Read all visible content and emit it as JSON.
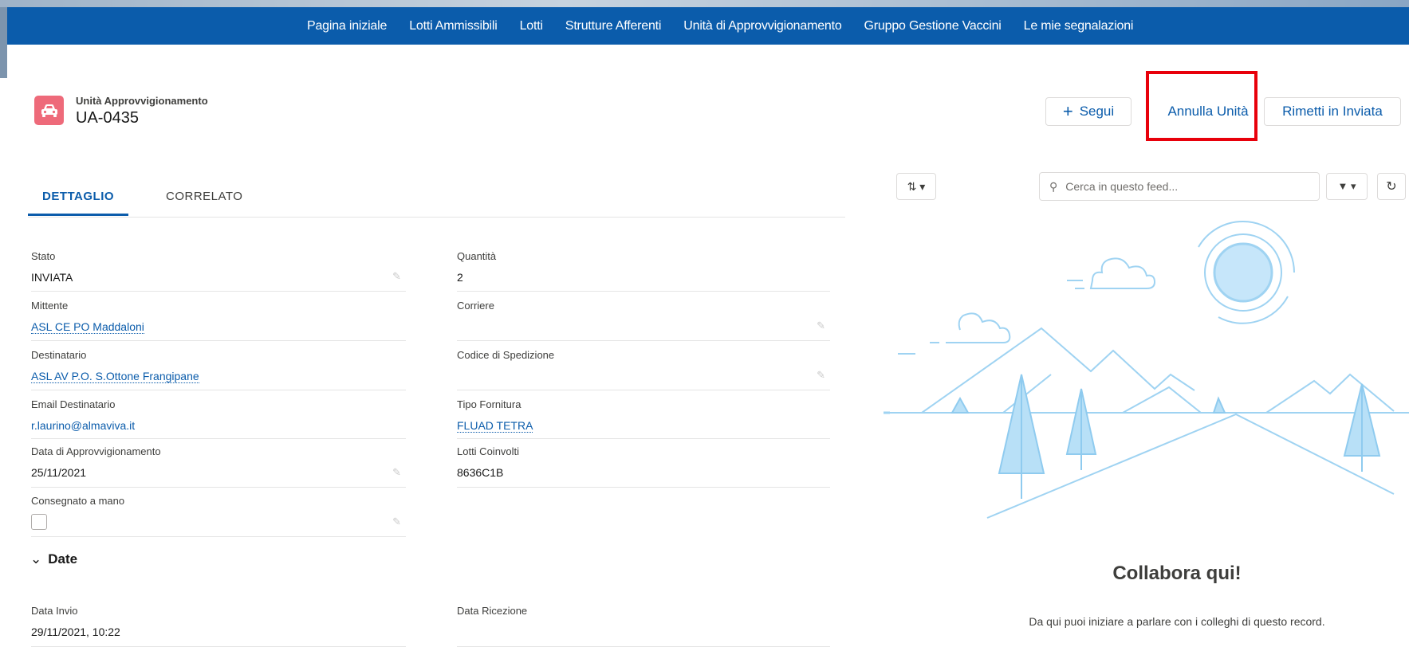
{
  "nav": {
    "items": [
      "Pagina iniziale",
      "Lotti Ammissibili",
      "Lotti",
      "Strutture Afferenti",
      "Unità di Approvvigionamento",
      "Gruppo Gestione Vaccini",
      "Le mie segnalazioni"
    ]
  },
  "record": {
    "type": "Unità Approvvigionamento",
    "name": "UA-0435",
    "icon": "car-icon"
  },
  "actions": {
    "follow": "Segui",
    "cancel": "Annulla Unità",
    "resend": "Rimetti in Inviata"
  },
  "tabs": {
    "detail": "DETTAGLIO",
    "related": "CORRELATO"
  },
  "fields": {
    "stato": {
      "label": "Stato",
      "value": "INVIATA"
    },
    "quantita": {
      "label": "Quantità",
      "value": "2"
    },
    "mittente": {
      "label": "Mittente",
      "value": "ASL CE PO Maddaloni"
    },
    "corriere": {
      "label": "Corriere",
      "value": ""
    },
    "destinatario": {
      "label": "Destinatario",
      "value": "ASL AV P.O. S.Ottone Frangipane"
    },
    "codice": {
      "label": "Codice di Spedizione",
      "value": ""
    },
    "email": {
      "label": "Email Destinatario",
      "value": "r.laurino@almaviva.it"
    },
    "fornitura": {
      "label": "Tipo Fornitura",
      "value": "FLUAD TETRA"
    },
    "data_appr": {
      "label": "Data di Approvvigionamento",
      "value": "25/11/2021"
    },
    "lotti": {
      "label": "Lotti Coinvolti",
      "value": "8636C1B"
    },
    "consegnato": {
      "label": "Consegnato a mano",
      "value": false
    },
    "data_invio": {
      "label": "Data Invio",
      "value": "29/11/2021, 10:22"
    },
    "data_ricezione": {
      "label": "Data Ricezione",
      "value": ""
    }
  },
  "section_date": "Date",
  "feed": {
    "search_placeholder": "Cerca in questo feed...",
    "title": "Collabora qui!",
    "subtitle": "Da qui puoi iniziare a parlare con i colleghi di questo record."
  },
  "colors": {
    "nav": "#0b5cab",
    "accent": "#0b5cab",
    "highlight": "#e8000b",
    "record_icon": "#ee6a7a"
  }
}
